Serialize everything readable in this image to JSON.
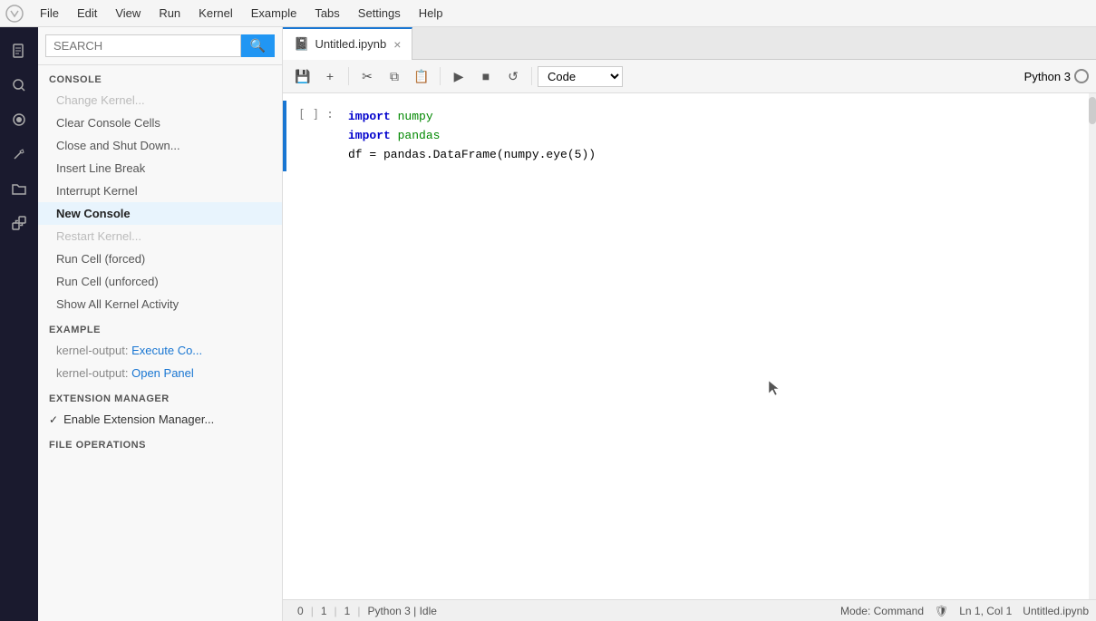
{
  "menubar": {
    "items": [
      "File",
      "Edit",
      "View",
      "Run",
      "Kernel",
      "Example",
      "Tabs",
      "Settings",
      "Help"
    ]
  },
  "icon_sidebar": {
    "icons": [
      {
        "name": "file-icon",
        "symbol": "📄",
        "active": false
      },
      {
        "name": "search-sidebar-icon",
        "symbol": "🔍",
        "active": false
      },
      {
        "name": "paint-icon",
        "symbol": "🎨",
        "active": false
      },
      {
        "name": "wrench-icon",
        "symbol": "🔧",
        "active": false
      },
      {
        "name": "folder-icon",
        "symbol": "📁",
        "active": false
      },
      {
        "name": "puzzle-icon",
        "symbol": "🧩",
        "active": false
      }
    ]
  },
  "search": {
    "placeholder": "SEARCH",
    "button_label": "🔍"
  },
  "console_section": {
    "header": "CONSOLE",
    "items": [
      {
        "label": "Change Kernel...",
        "active": false,
        "disabled": true
      },
      {
        "label": "Clear Console Cells",
        "active": false,
        "disabled": false
      },
      {
        "label": "Close and Shut Down...",
        "active": false,
        "disabled": false
      },
      {
        "label": "Insert Line Break",
        "active": false,
        "disabled": false
      },
      {
        "label": "Interrupt Kernel",
        "active": false,
        "disabled": false
      },
      {
        "label": "New Console",
        "active": true,
        "disabled": false
      },
      {
        "label": "Restart Kernel...",
        "active": false,
        "disabled": true
      },
      {
        "label": "Run Cell (forced)",
        "active": false,
        "disabled": false
      },
      {
        "label": "Run Cell (unforced)",
        "active": false,
        "disabled": false
      },
      {
        "label": "Show All Kernel Activity",
        "active": false,
        "disabled": false
      }
    ]
  },
  "example_section": {
    "header": "EXAMPLE",
    "items": [
      {
        "prefix": "kernel-output: ",
        "link": "Execute Co..."
      },
      {
        "prefix": "kernel-output: ",
        "link": "Open Panel"
      }
    ]
  },
  "extension_section": {
    "header": "EXTENSION MANAGER",
    "items": [
      {
        "label": "Enable Extension Manager...",
        "checked": true
      }
    ]
  },
  "file_operations_section": {
    "header": "FILE OPERATIONS"
  },
  "tab": {
    "title": "Untitled.ipynb",
    "close_label": "×"
  },
  "toolbar": {
    "save_label": "💾",
    "add_label": "+",
    "cut_label": "✂",
    "copy_label": "⧉",
    "paste_label": "📋",
    "run_label": "▶",
    "stop_label": "■",
    "restart_label": "↺",
    "cell_type": "Code",
    "kernel_name": "Python 3"
  },
  "editor": {
    "cell_prompt": "[ ] :",
    "code_lines": [
      {
        "text": "import numpy",
        "parts": [
          {
            "type": "kw",
            "text": "import"
          },
          {
            "type": "text",
            "text": " "
          },
          {
            "type": "mod",
            "text": "numpy"
          }
        ]
      },
      {
        "text": "import pandas",
        "parts": [
          {
            "type": "kw",
            "text": "import"
          },
          {
            "type": "text",
            "text": " "
          },
          {
            "type": "mod",
            "text": "pandas"
          }
        ]
      },
      {
        "text": "df = pandas.DataFrame(numpy.eye(5))",
        "parts": [
          {
            "type": "text",
            "text": "df = pandas.DataFrame(numpy.eye(5))"
          }
        ]
      }
    ]
  },
  "statusbar": {
    "cell_number": "0",
    "item1": "1",
    "item2": "1",
    "kernel_name": "Python 3 | Idle",
    "mode": "Mode: Command",
    "position": "Ln 1, Col 1",
    "filename": "Untitled.ipynb"
  }
}
